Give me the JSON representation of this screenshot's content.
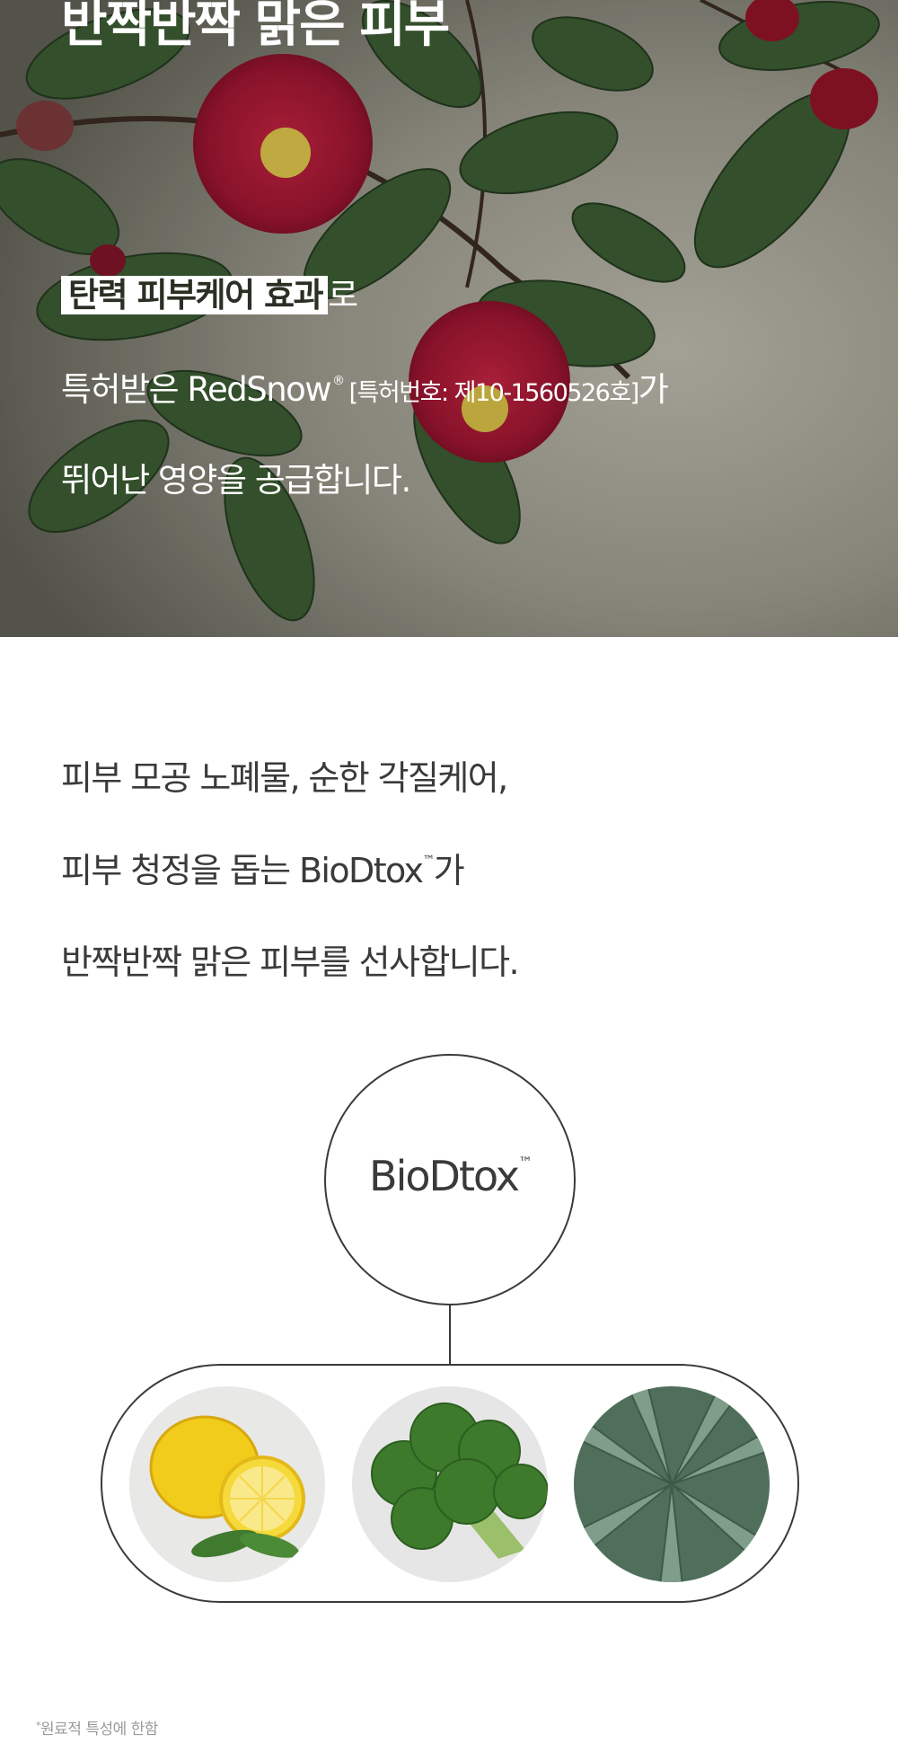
{
  "hero": {
    "title": "반짝반짝 맑은 피부",
    "line1_highlight": "탄력 피부케어 효과",
    "line1_rest": "로",
    "line2_pre": "특허받은 RedSnow",
    "line2_reg": "®",
    "line2_patent": "[특허번호: 제10-1560526호]",
    "line2_post": "가",
    "line3": "뛰어난 영양을 공급합니다."
  },
  "body": {
    "line1": "피부 모공 노폐물, 순한 각질케어,",
    "line2_pre": "피부 청정을 돕는 BioDtox",
    "line2_tm": "™",
    "line2_post": "가",
    "line3": "반짝반짝 맑은 피부를 선사합니다."
  },
  "diagram": {
    "center_label": "BioDtox",
    "center_tm": "™",
    "ingredients": [
      "lemon-image",
      "broccoli-image",
      "aloe-image"
    ]
  },
  "footnote": {
    "star": "*",
    "text": "원료적 특성에 한함"
  },
  "colors": {
    "text": "#3a3a3a",
    "camellia_red": "#a3162f",
    "leaf_green": "#3b5a32"
  }
}
